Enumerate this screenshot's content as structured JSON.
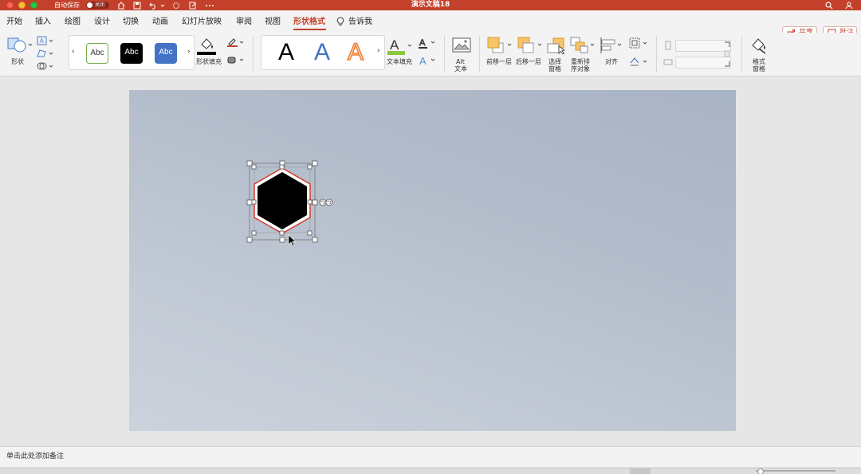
{
  "window": {
    "autosave_label": "自动保存",
    "autosave_state": "关闭",
    "title": "演示文稿18"
  },
  "tabs": [
    "开始",
    "插入",
    "绘图",
    "设计",
    "切换",
    "动画",
    "幻灯片放映",
    "审阅",
    "视图",
    "形状格式",
    "告诉我"
  ],
  "active_tab": "形状格式",
  "share_label": "共享",
  "comment_label": "批注",
  "ribbon": {
    "shape_label": "形状",
    "shape_styles": [
      "Abc",
      "Abc",
      "Abc"
    ],
    "shape_fill_label": "形状填充",
    "wordart_letter": "A",
    "text_fill_label": "文本填充",
    "alt_text_label_1": "Alt",
    "alt_text_label_2": "文本",
    "bring_forward_label": "前移一层",
    "send_backward_label": "后移一层",
    "selection_pane_label_1": "选择",
    "selection_pane_label_2": "窗格",
    "reorder_label_1": "重新排",
    "reorder_label_2": "序对象",
    "align_label": "对齐",
    "format_pane_label_1": "格式",
    "format_pane_label_2": "窗格"
  },
  "notes_placeholder": "单击此处添加备注",
  "colors": {
    "accent": "#c3412b",
    "slide_background": "#b4bdcb",
    "shape_fill": "#000000",
    "style_blue": "#4472c4",
    "style_green_border": "#70ad47",
    "text_fill_bar": "#8dc63f"
  },
  "icons": [
    "home-icon",
    "save-icon",
    "undo-icon",
    "redo-icon",
    "more-icon",
    "search-icon",
    "person-icon",
    "lightbulb-icon"
  ]
}
